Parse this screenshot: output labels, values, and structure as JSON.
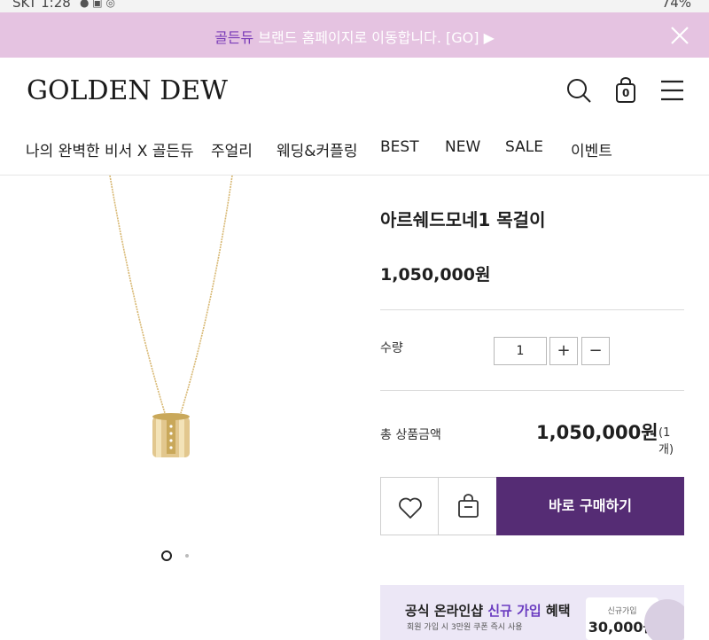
{
  "status_bar": {
    "carrier_time": "SKT 1:28",
    "battery": "74%"
  },
  "promo": {
    "brand": "골든듀",
    "message": " 브랜드 홈페이지로 이동합니다. [GO] ▶"
  },
  "header": {
    "logo": "GOLDEN DEW",
    "cart_count": "0"
  },
  "nav": {
    "items": [
      "나의 완벽한 비서 X 골든듀",
      "주얼리",
      "웨딩&커플링",
      "BEST",
      "NEW",
      "SALE",
      "이벤트"
    ]
  },
  "product": {
    "title": "아르쉐드모네1 목걸이",
    "price": "1,050,000원",
    "quantity_label": "수량",
    "quantity": "1",
    "plus": "+",
    "minus": "−",
    "total_label": "총 상품금액",
    "total_price": "1,050,000원",
    "total_count": "(1개)",
    "buy_button": "바로 구매하기"
  },
  "benefit": {
    "prefix": "공식 온라인샵 ",
    "highlight": "신규 가입",
    "suffix": " 혜택",
    "sub": "회원 가입 시 3만원 쿠폰 즉시 사용",
    "coupon_title": "신규가입",
    "coupon_value": "30,000원"
  },
  "colors": {
    "promo_bg": "#e5c3e1",
    "brand_accent": "#7a3cb8",
    "buy_button": "#552c74",
    "benefit_bg": "#ece7f6",
    "gold": "#d8b873"
  },
  "icons": {
    "close": "close-icon",
    "search": "search-icon",
    "cart": "shopping-bag-icon",
    "menu": "hamburger-menu-icon",
    "wish": "heart-icon",
    "add_to_cart": "shopping-bag-icon"
  }
}
